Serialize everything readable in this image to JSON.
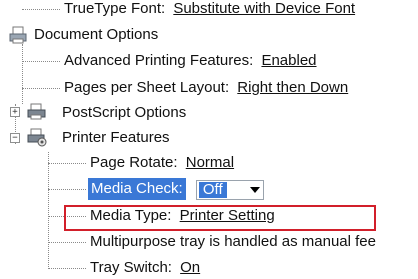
{
  "tree": {
    "truetype_font": {
      "label": "TrueType Font:",
      "value": "Substitute with Device Font"
    },
    "document_options": {
      "label": "Document Options",
      "icon": "printer-document-icon"
    },
    "advanced_printing": {
      "label": "Advanced Printing Features:",
      "value": "Enabled"
    },
    "pages_per_sheet": {
      "label": "Pages per Sheet Layout:",
      "value": "Right then Down"
    },
    "postscript_options": {
      "label": "PostScript Options",
      "expander": "+",
      "icon": "printer-icon"
    },
    "printer_features": {
      "label": "Printer Features",
      "expander": "−",
      "icon": "printer-gear-icon"
    },
    "page_rotate": {
      "label": "Page Rotate:",
      "value": "Normal"
    },
    "media_check": {
      "label": "Media Check:",
      "value": "Off"
    },
    "media_type": {
      "label": "Media Type:",
      "value": "Printer Setting"
    },
    "multipurpose_tray": {
      "label": "Multipurpose tray is handled as manual fee"
    },
    "tray_switch": {
      "label": "Tray Switch:",
      "value": "On"
    }
  },
  "colors": {
    "selection": "#3a78d6",
    "highlight_border": "#d21f2a"
  }
}
